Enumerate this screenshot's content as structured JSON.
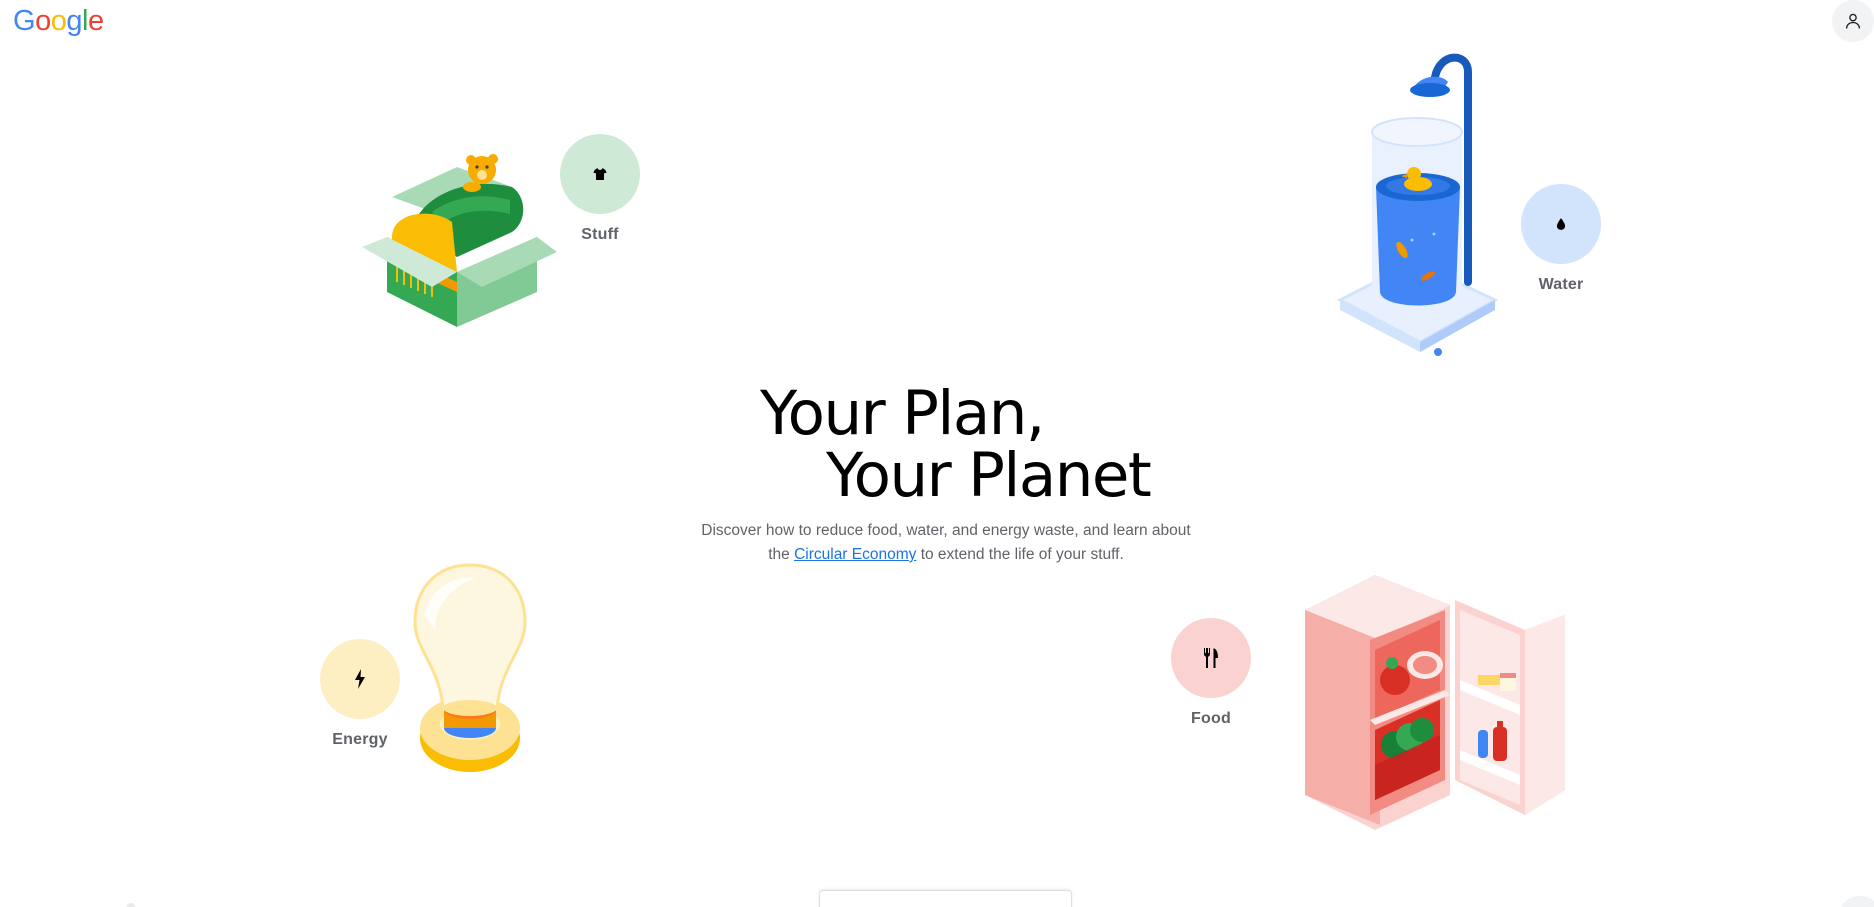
{
  "header": {
    "logo_letters": [
      {
        "ch": "G",
        "color": "#4285F4"
      },
      {
        "ch": "o",
        "color": "#EA4335"
      },
      {
        "ch": "o",
        "color": "#FBBC05"
      },
      {
        "ch": "g",
        "color": "#4285F4"
      },
      {
        "ch": "l",
        "color": "#34A853"
      },
      {
        "ch": "e",
        "color": "#EA4335"
      }
    ],
    "account_icon": "person-icon"
  },
  "categories": {
    "stuff": {
      "label": "Stuff",
      "icon": "tshirt-icon",
      "bg": "#ceead6"
    },
    "water": {
      "label": "Water",
      "icon": "water-drop-icon",
      "bg": "#d2e3fc"
    },
    "energy": {
      "label": "Energy",
      "icon": "lightning-bolt-icon",
      "bg": "#feefc3"
    },
    "food": {
      "label": "Food",
      "icon": "fork-knife-icon",
      "bg": "#fad2cf"
    }
  },
  "hero": {
    "title_line1": "Your Plan,",
    "title_line2": "Your Planet",
    "desc_part1": "Discover how to reduce food, water, and energy waste, and learn about the ",
    "desc_link": "Circular Economy",
    "desc_part2": " to extend the life of your stuff."
  }
}
